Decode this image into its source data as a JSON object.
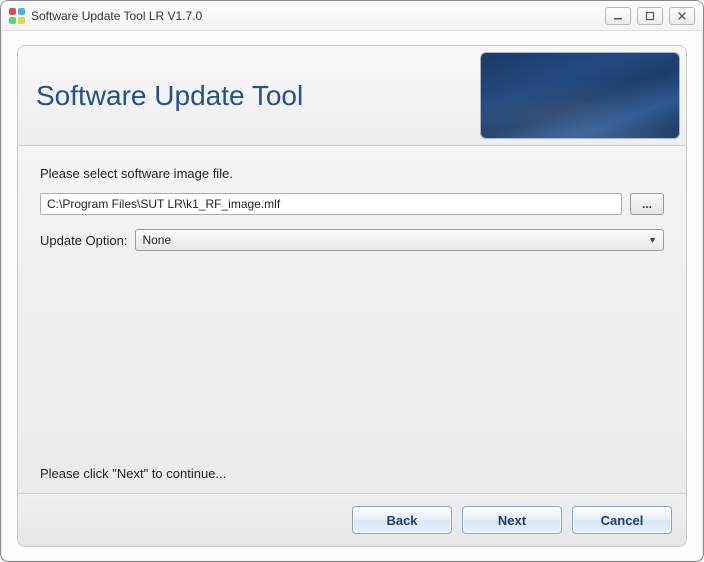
{
  "window": {
    "title": "Software Update Tool LR V1.7.0"
  },
  "hero": {
    "title": "Software Update Tool"
  },
  "main": {
    "instruction": "Please select software image file.",
    "file_path": "C:\\Program Files\\SUT LR\\k1_RF_image.mlf",
    "browse_label": "...",
    "option_label": "Update Option:",
    "option_selected": "None",
    "hint": "Please click \"Next\" to continue..."
  },
  "footer": {
    "back": "Back",
    "next": "Next",
    "cancel": "Cancel"
  }
}
